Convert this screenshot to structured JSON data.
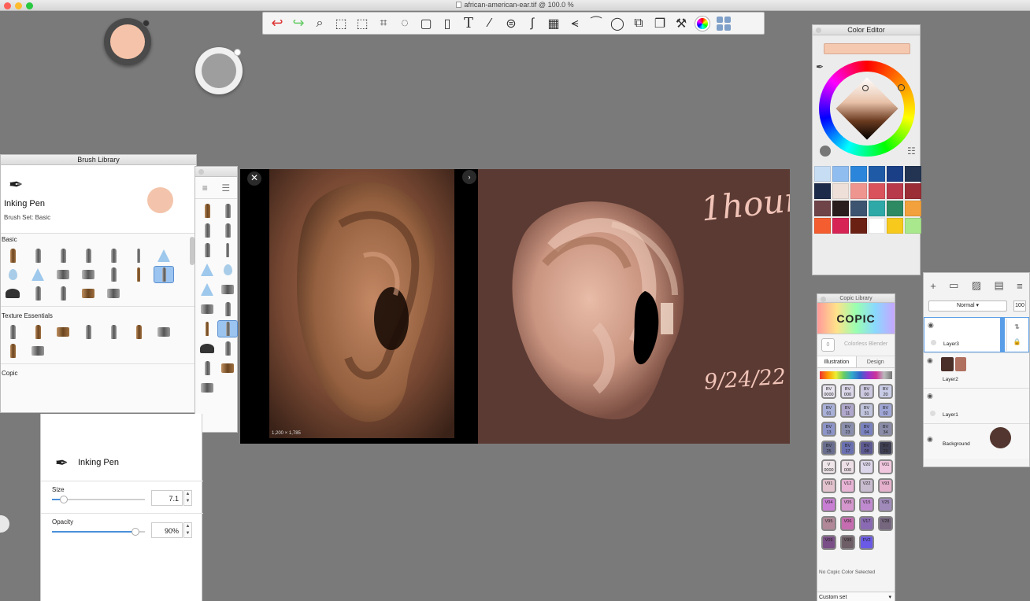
{
  "window": {
    "title": "african-american-ear.tif @ 100.0 %"
  },
  "toolbar": {
    "tools": [
      "undo-icon",
      "redo-icon",
      "zoom-icon",
      "select-rect-icon",
      "select-free-icon",
      "crop-icon",
      "transform-icon",
      "distort-icon",
      "fill-icon",
      "text-icon",
      "ruler-icon",
      "ellipse-guide-icon",
      "curve-icon",
      "perspective-icon",
      "symmetry-icon",
      "stroke-icon",
      "lasso-ellipse-icon",
      "shape-icon",
      "layers-copy-icon",
      "brushes-icon",
      "color-wheel-icon",
      "panels-icon"
    ]
  },
  "colors": {
    "current": "#f5c3a9",
    "secondary": "#9e9e9e",
    "accent": "#5a9ee8"
  },
  "brush_library": {
    "title": "Brush Library",
    "brush_name": "Inking Pen",
    "brush_set": "Brush Set: Basic",
    "sections": [
      "Basic",
      "Texture Essentials",
      "Copic"
    ]
  },
  "brush_props": {
    "brush_name": "Inking Pen",
    "size_label": "Size",
    "size_value": "7.1",
    "size_fraction": 0.13,
    "opacity_label": "Opacity",
    "opacity_value": "90%",
    "opacity_fraction": 0.9
  },
  "canvas": {
    "image_dims": "1,200 × 1,785",
    "annotation_time": "1hour",
    "annotation_date": "9/24/22"
  },
  "color_editor": {
    "title": "Color Editor",
    "palette": [
      "#c7ddf3",
      "#8fbdf0",
      "#2b86db",
      "#1f5aa6",
      "#1b3f86",
      "#223451",
      "#1d2b4a",
      "#eee0d8",
      "#ef9590",
      "#d9535c",
      "#b8394a",
      "#9a2d35",
      "#6e4449",
      "#2a1d1d",
      "#3c5470",
      "#2fa9a8",
      "#2e8a62",
      "#f3a13c",
      "#f45d2f",
      "#d62455",
      "#6b2014",
      "#ffffff",
      "#f6c91c",
      "#a9e88c"
    ]
  },
  "copic": {
    "title": "Copic Library",
    "logo": "COPIC",
    "blender_code": "0",
    "blender_label": "Colorless Blender",
    "tab_illustration": "Illustration",
    "tab_design": "Design",
    "chips": [
      {
        "c": "BV\n0000",
        "col": "#e8e4ef"
      },
      {
        "c": "BV\n000",
        "col": "#dcd8ea"
      },
      {
        "c": "BV\n00",
        "col": "#ccc8e0"
      },
      {
        "c": "BV\n20",
        "col": "#c9cce6"
      },
      {
        "c": "BV\n01",
        "col": "#a9b0d8"
      },
      {
        "c": "BV\n11",
        "col": "#b0a8cc"
      },
      {
        "c": "BV\n31",
        "col": "#c0c4dc"
      },
      {
        "c": "BV\n02",
        "col": "#9fa6d6"
      },
      {
        "c": "BV\n13",
        "col": "#8c94c8"
      },
      {
        "c": "BV\n23",
        "col": "#8b8fae"
      },
      {
        "c": "BV\n04",
        "col": "#7a82c0"
      },
      {
        "c": "BV\n34",
        "col": "#8a8ca8"
      },
      {
        "c": "BV\n25",
        "col": "#6a6e8e"
      },
      {
        "c": "BV\n17",
        "col": "#6a70b0"
      },
      {
        "c": "BV\n08",
        "col": "#5e5a92"
      },
      {
        "c": "BV\n29",
        "col": "#3e3e52"
      },
      {
        "c": "V\n0000",
        "col": "#efe6ea"
      },
      {
        "c": "V\n000",
        "col": "#ecdfe6"
      },
      {
        "c": "V20",
        "col": "#dcd6ea"
      },
      {
        "c": "V01",
        "col": "#f0c6de"
      },
      {
        "c": "V91",
        "col": "#e2c2cc"
      },
      {
        "c": "V12",
        "col": "#e8b4d6"
      },
      {
        "c": "V22",
        "col": "#c8bcd0"
      },
      {
        "c": "V93",
        "col": "#e4b0cc"
      },
      {
        "c": "V04",
        "col": "#c87ed2"
      },
      {
        "c": "V05",
        "col": "#d496cc"
      },
      {
        "c": "V15",
        "col": "#c08ad0"
      },
      {
        "c": "V25",
        "col": "#a08aba"
      },
      {
        "c": "V95",
        "col": "#b08898"
      },
      {
        "c": "V06",
        "col": "#c66cb0"
      },
      {
        "c": "V17",
        "col": "#8a6ab2"
      },
      {
        "c": "V28",
        "col": "#76667e"
      },
      {
        "c": "V09",
        "col": "#7a4e86"
      },
      {
        "c": "V99",
        "col": "#6e5e66"
      },
      {
        "c": "FV2",
        "col": "#6a5ae6"
      }
    ],
    "none_selected": "No Copic Color Selected",
    "custom_set": "Custom set"
  },
  "layers": {
    "blend_mode": "Normal",
    "opacity": "100",
    "items": [
      "Layer3",
      "Layer2",
      "Layer1",
      "Background"
    ]
  }
}
